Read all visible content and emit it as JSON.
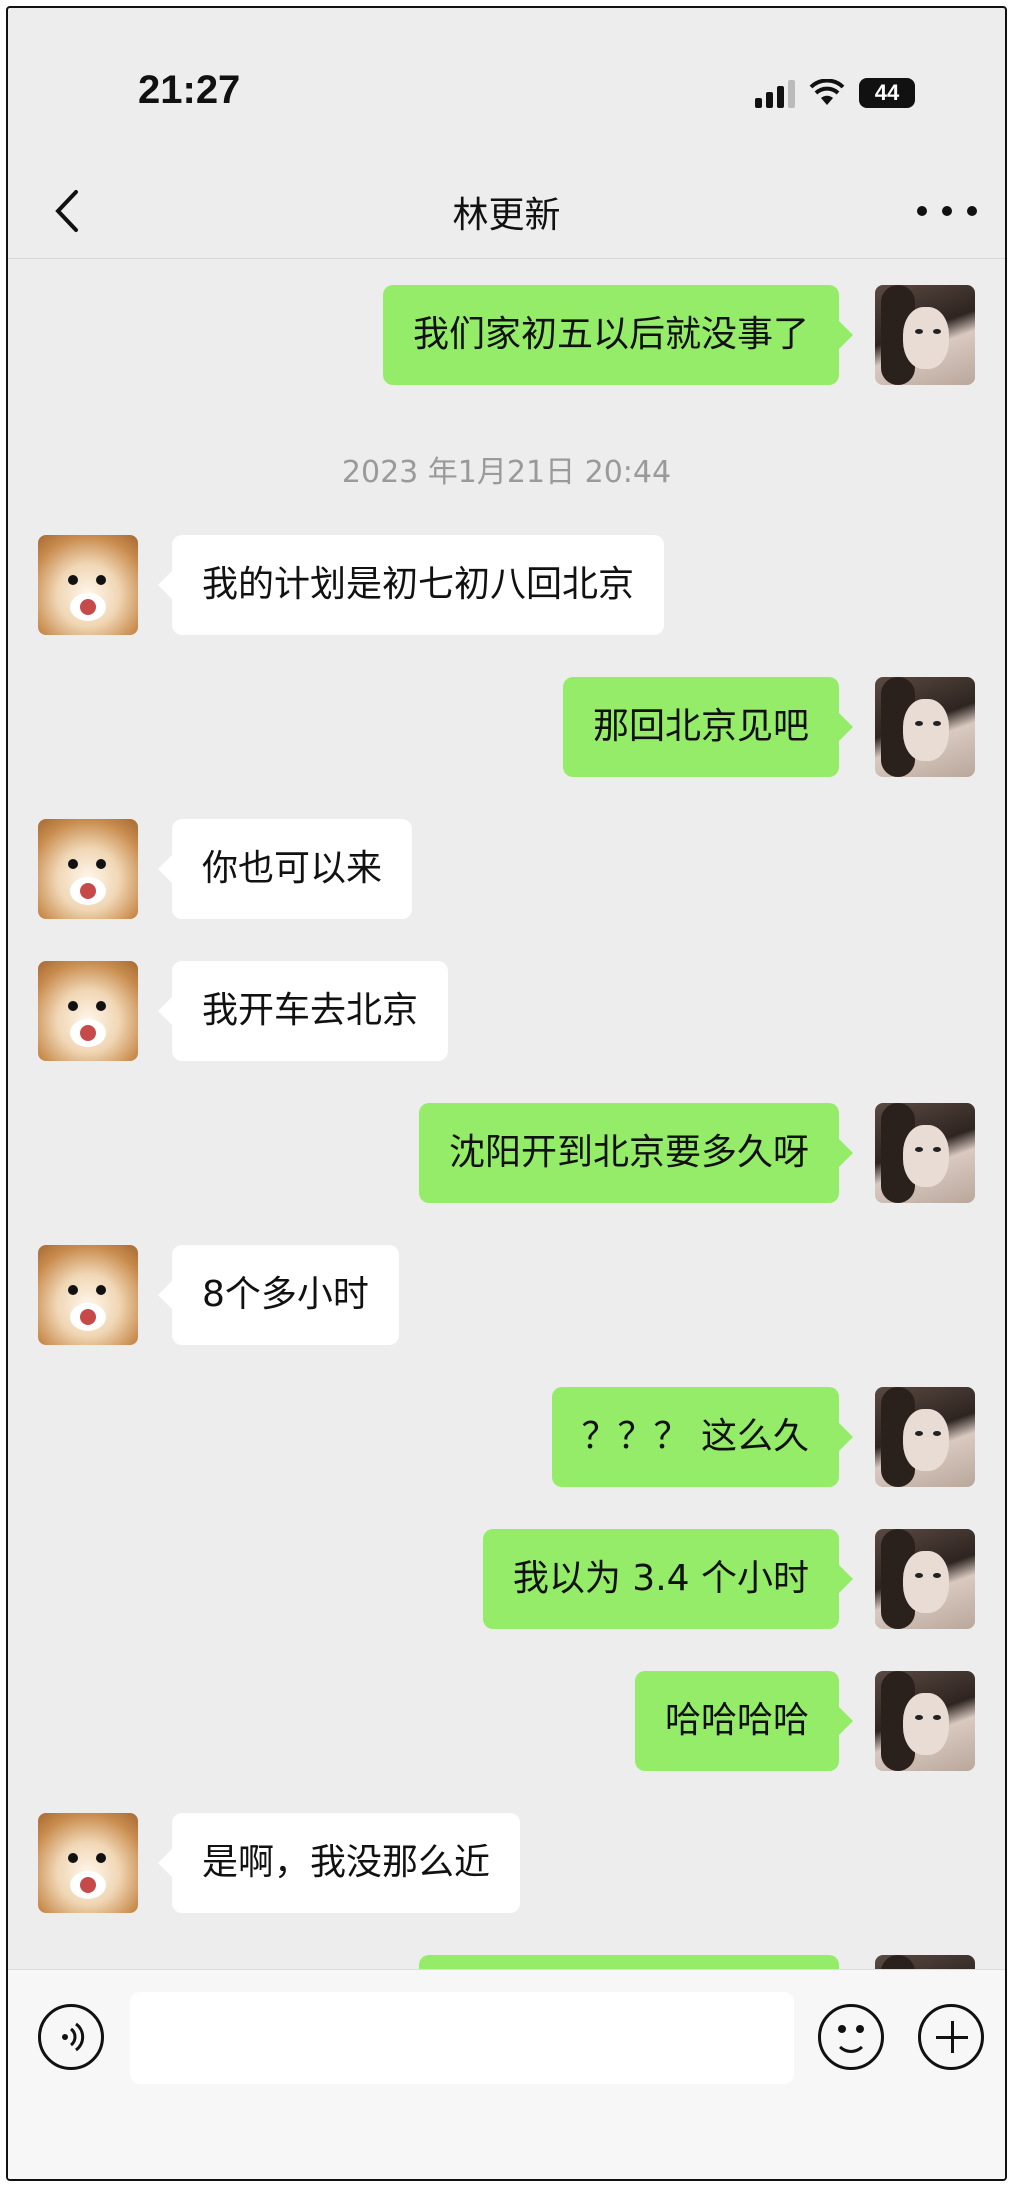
{
  "status_bar": {
    "time": "21:27",
    "battery": "44"
  },
  "header": {
    "title": "林更新",
    "more_icon": "more-horizontal-icon",
    "back_icon": "chevron-left-icon"
  },
  "colors": {
    "background": "#ededed",
    "outgoing_bubble": "#95ec69",
    "incoming_bubble": "#ffffff",
    "timestamp": "#9a9a9a"
  },
  "messages": [
    {
      "direction": "outgoing",
      "text": "我们家初五以后就没事了"
    },
    {
      "type": "timestamp",
      "text": "2023 年1月21日 20:44"
    },
    {
      "direction": "incoming",
      "text": "我的计划是初七初八回北京"
    },
    {
      "direction": "outgoing",
      "text": "那回北京见吧"
    },
    {
      "direction": "incoming",
      "text": "你也可以来"
    },
    {
      "direction": "incoming",
      "text": "我开车去北京"
    },
    {
      "direction": "outgoing",
      "text": "沈阳开到北京要多久呀"
    },
    {
      "direction": "incoming",
      "text": "8个多小时"
    },
    {
      "direction": "outgoing",
      "text": "？？？ 这么久"
    },
    {
      "direction": "outgoing",
      "text": "我以为 3.4 个小时"
    },
    {
      "direction": "outgoing",
      "text": "哈哈哈哈"
    },
    {
      "direction": "incoming",
      "text": "是啊，我没那么近"
    },
    {
      "direction": "outgoing",
      "text": ""
    }
  ],
  "input_bar": {
    "voice_icon": "voice-icon",
    "emoji_icon": "emoji-icon",
    "plus_icon": "plus-icon",
    "placeholder": ""
  }
}
